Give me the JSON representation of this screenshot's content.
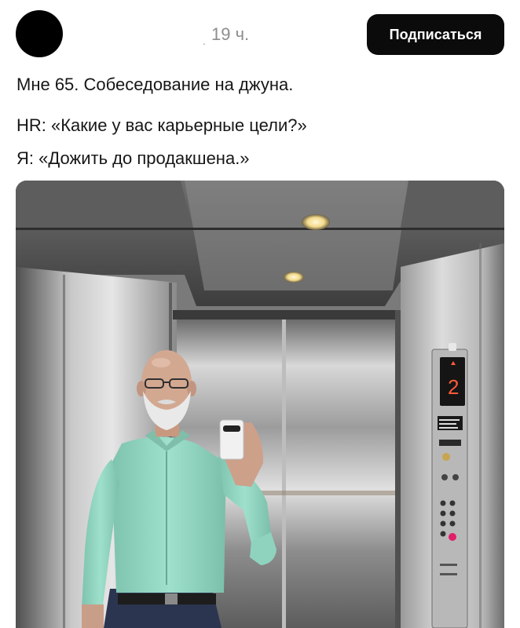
{
  "post": {
    "author_avatar": "avatar-redacted",
    "time": "19 ч.",
    "subscribe_label": "Подписаться",
    "lines": [
      "Мне 65. Собеседование на джуна.",
      "HR: «Какие у вас карьерные цели?»",
      "Я: «Дожить до продакшена.»"
    ],
    "photo": {
      "subject": "elevator-selfie",
      "floor_display": "2"
    }
  },
  "colors": {
    "button_bg": "#0b0b0b",
    "button_text": "#ffffff",
    "time_text": "#8d8d8d",
    "shirt": "#8fd3bf",
    "trousers": "#2b3550"
  }
}
